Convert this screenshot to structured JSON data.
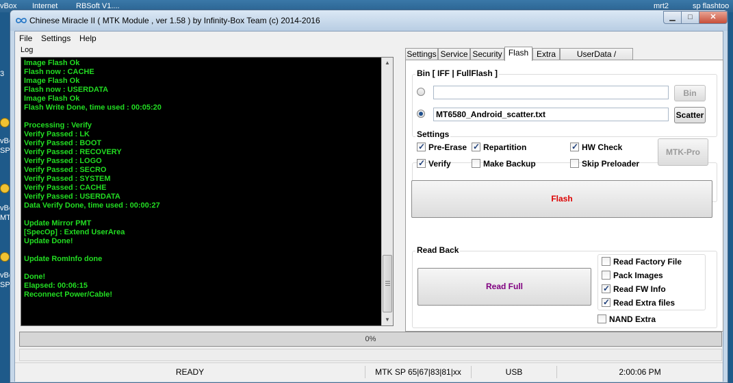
{
  "desktop": {
    "top_items": [
      "vBox",
      "Internet",
      "RBSoft V1....",
      "mrt2",
      "sp flashtoo"
    ],
    "left_fragments": [
      "3",
      "vBox",
      "SPD",
      "vBox",
      "MT",
      "vBox",
      "SP"
    ]
  },
  "window": {
    "title": "Chinese Miracle II ( MTK Module , ver 1.58 ) by Infinity-Box Team (c) 2014-2016",
    "min_glyph": "▁",
    "max_glyph": "□",
    "close_glyph": "✕"
  },
  "menu": [
    "File",
    "Settings",
    "Help"
  ],
  "log": {
    "label": "Log",
    "lines": [
      "Image Flash Ok",
      "Flash now : CACHE",
      "Image Flash Ok",
      "Flash now : USERDATA",
      "Image Flash Ok",
      "Flash Write Done, time used : 00:05:20",
      "",
      "Processing : Verify",
      "Verify Passed : LK",
      "Verify Passed : BOOT",
      "Verify Passed : RECOVERY",
      "Verify Passed : LOGO",
      "Verify Passed : SECRO",
      "Verify Passed : SYSTEM",
      "Verify Passed : CACHE",
      "Verify Passed : USERDATA",
      "Data Verify Done, time used : 00:00:27",
      "",
      "Update Mirror PMT",
      "[SpecOp] : Extend UserArea",
      "Update Done!",
      "",
      "Update RomInfo done",
      "",
      "Done!",
      "Elapsed: 00:06:15",
      "Reconnect Power/Cable!"
    ]
  },
  "tabs": [
    "Settings",
    "Service",
    "Security",
    "Flash",
    "Extra",
    "UserData / Forensic"
  ],
  "active_tab": "Flash",
  "flash": {
    "bin_group_title": "Bin  [ IFF | FullFlash ]",
    "bin_path": "",
    "bin_button": "Bin",
    "scatter_path": "MT6580_Android_scatter.txt",
    "scatter_button": "Scatter",
    "selected_source": "scatter",
    "settings_title": "Settings",
    "checkboxes": [
      {
        "label": "Pre-Erase",
        "checked": true
      },
      {
        "label": "Repartition",
        "checked": true
      },
      {
        "label": "HW Check",
        "checked": true
      },
      {
        "label": "Verify",
        "checked": true
      },
      {
        "label": "Make Backup",
        "checked": false
      },
      {
        "label": "Skip Preloader",
        "checked": false
      }
    ],
    "mtk_pro_button": "MTK-Pro",
    "flash_button": "Flash",
    "flash_button_color": "#dd0000",
    "readback_title": "Read Back",
    "read_full_button": "Read Full",
    "read_full_color": "#800080",
    "readback_options": [
      {
        "label": "Read Factory File",
        "checked": false
      },
      {
        "label": "Pack Images",
        "checked": false
      },
      {
        "label": "Read FW Info",
        "checked": true
      },
      {
        "label": "Read Extra files",
        "checked": true
      }
    ],
    "nand_extra": {
      "label": "NAND Extra",
      "checked": false
    }
  },
  "progress": {
    "text": "0%",
    "value": 0
  },
  "status": {
    "state": "READY",
    "chip": "MTK SP 65|67|83|81|xx",
    "connection": "USB",
    "time": "2:00:06 PM"
  }
}
